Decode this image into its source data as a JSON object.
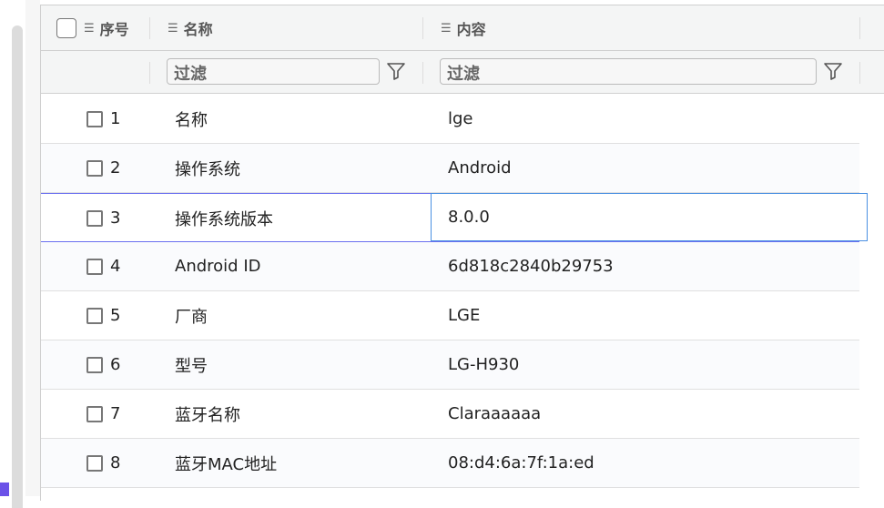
{
  "header": {
    "seq": "序号",
    "name": "名称",
    "content": "内容"
  },
  "filter": {
    "placeholder": "过滤"
  },
  "rows": [
    {
      "no": "1",
      "name": "名称",
      "value": "lge"
    },
    {
      "no": "2",
      "name": "操作系统",
      "value": "Android"
    },
    {
      "no": "3",
      "name": "操作系统版本",
      "value": "8.0.0"
    },
    {
      "no": "4",
      "name": "Android ID",
      "value": "6d818c2840b29753"
    },
    {
      "no": "5",
      "name": "厂商",
      "value": "LGE"
    },
    {
      "no": "6",
      "name": "型号",
      "value": "LG-H930"
    },
    {
      "no": "7",
      "name": "蓝牙名称",
      "value": "Claraaaaaa"
    },
    {
      "no": "8",
      "name": "蓝牙MAC地址",
      "value": "08:d4:6a:7f:1a:ed"
    }
  ]
}
